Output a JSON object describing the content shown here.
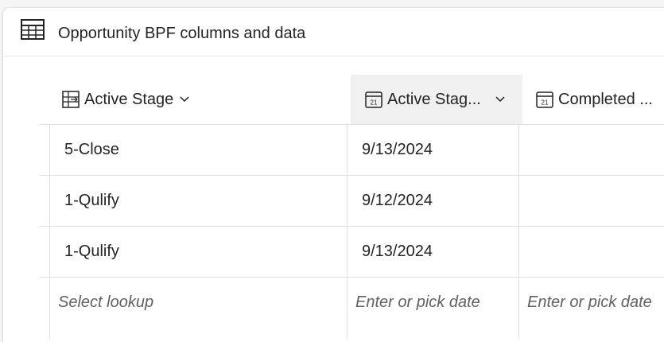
{
  "card": {
    "title": "Opportunity BPF columns and data",
    "icon": "table-icon"
  },
  "columns": [
    {
      "label": "Active Stage",
      "icon": "stage-lookup-icon",
      "has_chevron": true,
      "selected": false
    },
    {
      "label": "Active Stag...",
      "icon": "calendar-icon",
      "has_chevron": true,
      "selected": true
    },
    {
      "label": "Completed ...",
      "icon": "calendar-icon",
      "has_chevron": false,
      "selected": false
    }
  ],
  "rows": [
    {
      "active_stage": "5-Close",
      "active_stage_date": "9/13/2024",
      "completed": ""
    },
    {
      "active_stage": "1-Qulify",
      "active_stage_date": "9/12/2024",
      "completed": ""
    },
    {
      "active_stage": "1-Qulify",
      "active_stage_date": "9/13/2024",
      "completed": ""
    }
  ],
  "new_row": {
    "lookup_placeholder": "Select lookup",
    "date_placeholder": "Enter or pick date",
    "completed_placeholder": "Enter or pick date"
  },
  "colors": {
    "background": "#f5f5f5",
    "card": "#ffffff",
    "selected_header": "#f0f0f0",
    "grid_line": "#e0e0e0",
    "text": "#242424",
    "placeholder": "#616161"
  }
}
